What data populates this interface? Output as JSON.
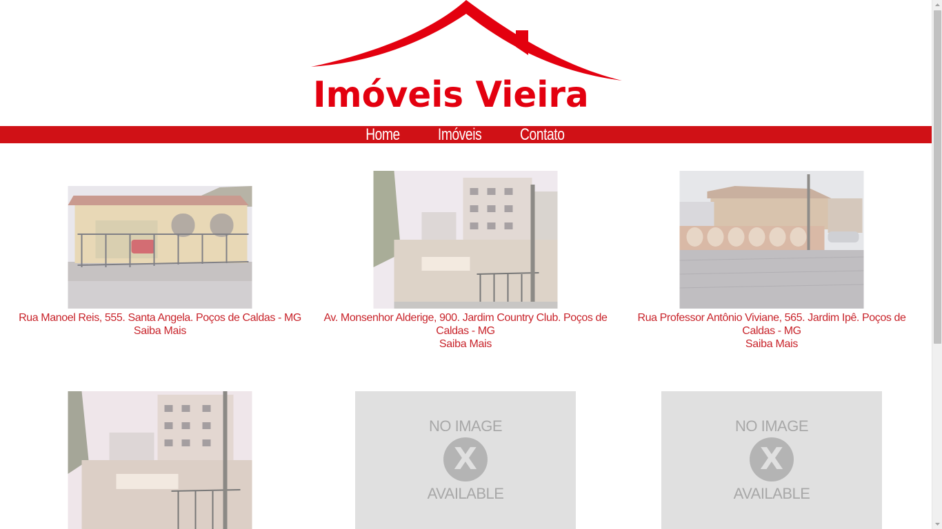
{
  "brand": {
    "name": "Imóveis Vieira",
    "color": "#e3000f"
  },
  "nav": {
    "items": [
      {
        "label": "Home"
      },
      {
        "label": "Imóveis"
      },
      {
        "label": "Contato"
      }
    ],
    "bar_color": "#d01116"
  },
  "listings": [
    {
      "address": "Rua Manoel Reis, 555. Santa Angela. Poços de Caldas - MG",
      "more": "Saiba Mais",
      "image": "photo"
    },
    {
      "address": "Av. Monsenhor Alderige, 900. Jardim Country Club. Poços de Caldas - MG",
      "more": "Saiba Mais",
      "image": "photo"
    },
    {
      "address": "Rua Professor Antônio Viviane, 565. Jardim Ipê. Poços de Caldas - MG",
      "more": "Saiba Mais",
      "image": "photo"
    },
    {
      "image": "photo"
    },
    {
      "image": "no-image",
      "no_image_top": "NO IMAGE",
      "no_image_bottom": "AVAILABLE",
      "no_image_mark": "X"
    },
    {
      "image": "no-image",
      "no_image_top": "NO IMAGE",
      "no_image_bottom": "AVAILABLE",
      "no_image_mark": "X"
    }
  ],
  "caption_color": "#c8232a"
}
